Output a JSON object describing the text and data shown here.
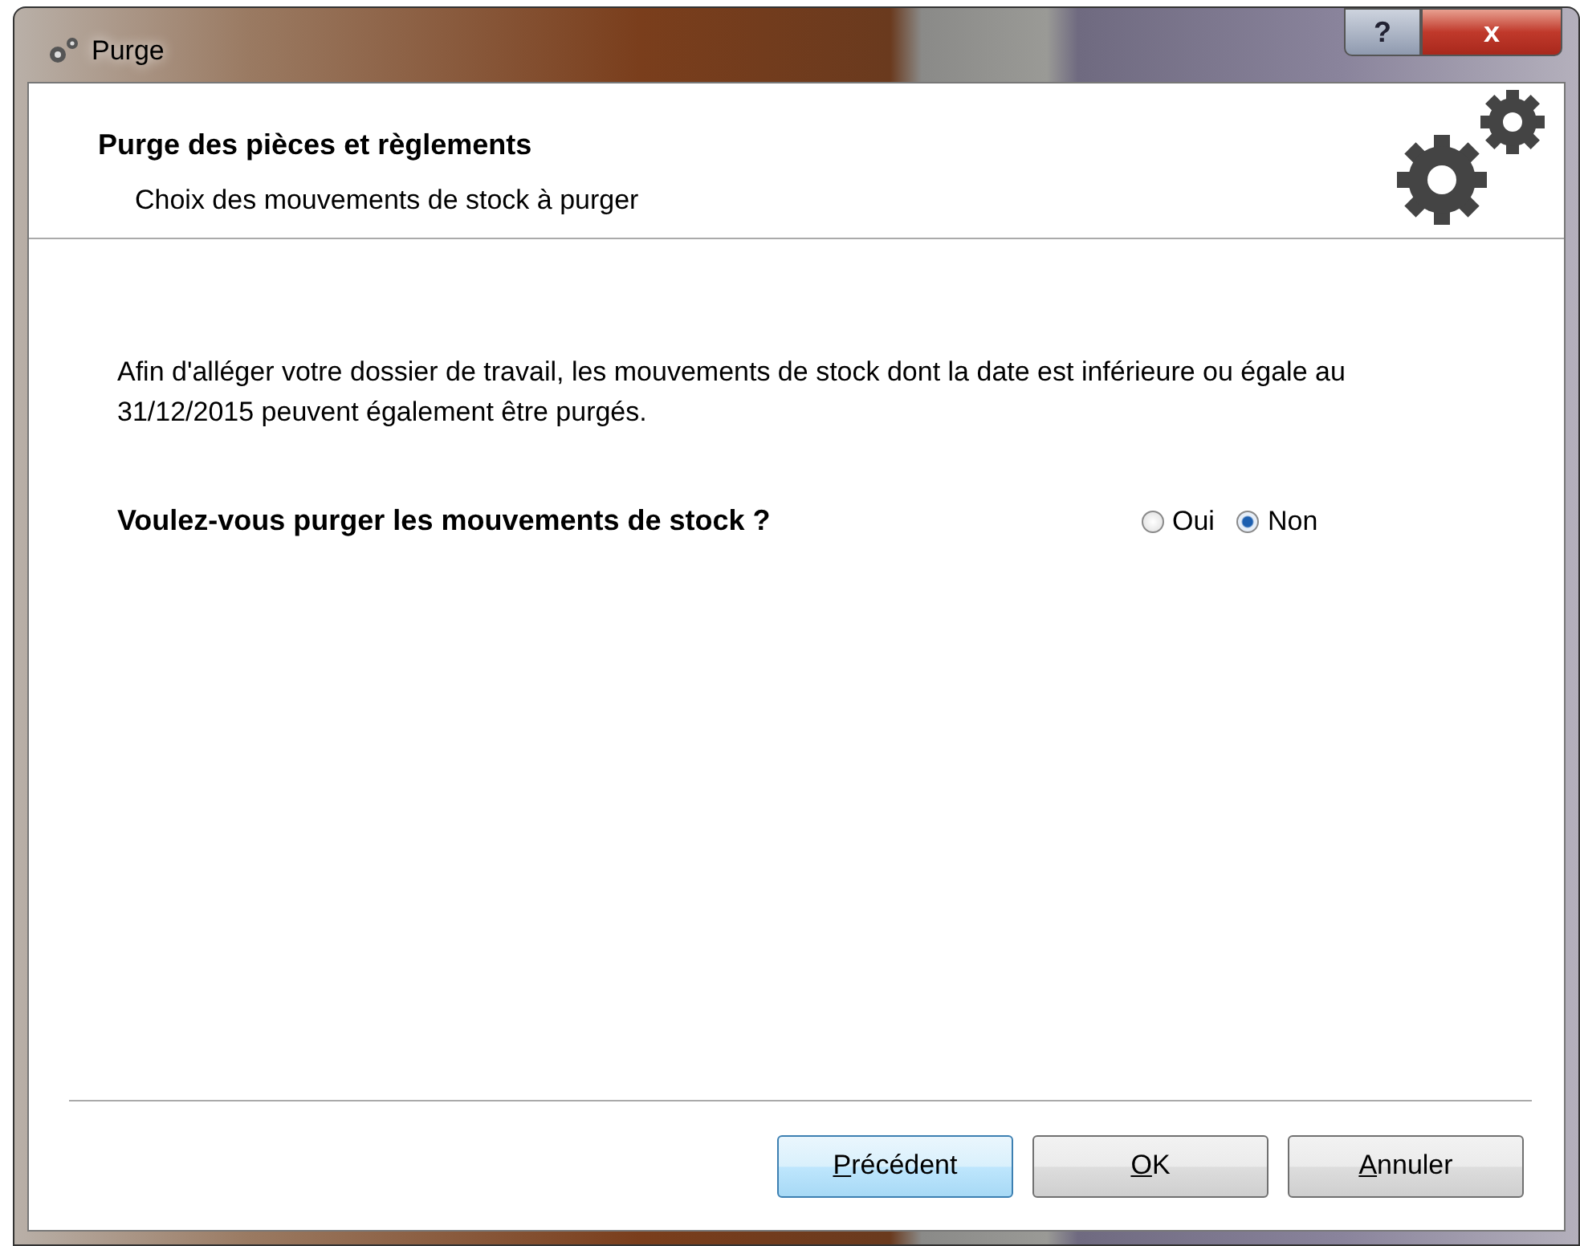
{
  "window": {
    "title": "Purge",
    "help": "?",
    "close": "x"
  },
  "header": {
    "title": "Purge des pièces et règlements",
    "subtitle": "Choix des mouvements de stock à purger"
  },
  "body": {
    "text": "Afin d'alléger votre dossier de travail, les mouvements de stock dont la date est inférieure ou égale au 31/12/2015 peuvent également être purgés.",
    "question": "Voulez-vous purger les mouvements de stock ?",
    "options": [
      {
        "label": "Oui",
        "selected": false
      },
      {
        "label": "Non",
        "selected": true
      }
    ]
  },
  "buttons": [
    {
      "accel": "P",
      "rest": "récédent",
      "focused": true
    },
    {
      "accel": "O",
      "rest": "K",
      "focused": false
    },
    {
      "accel": "A",
      "rest": "nnuler",
      "focused": false
    }
  ]
}
